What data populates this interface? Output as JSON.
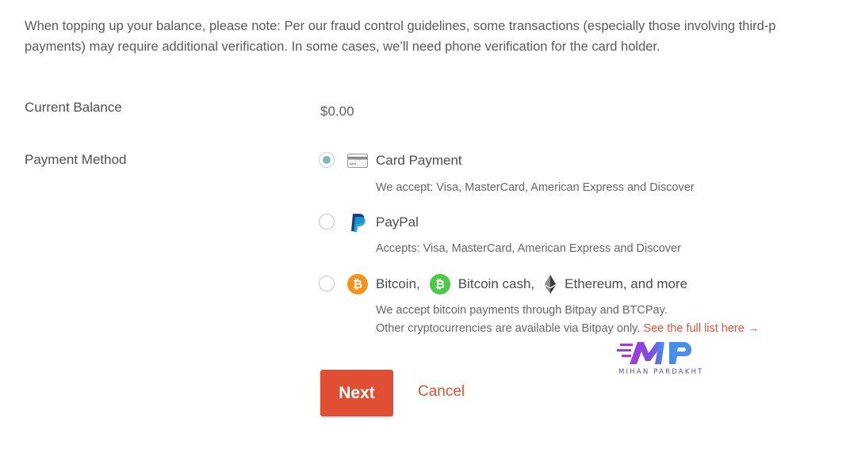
{
  "notice": {
    "line1": "When topping up your balance, please note: Per our fraud control guidelines, some transactions (especially those involving third-p",
    "line2": "payments) may require additional verification. In some cases, we’ll need phone verification for the card holder."
  },
  "balance": {
    "label": "Current Balance",
    "value": "$0.00"
  },
  "payment": {
    "label": "Payment Method",
    "options": [
      {
        "title": "Card Payment",
        "description": "We accept: Visa, MasterCard, American Express and Discover",
        "selected": true,
        "icon": "credit-card-icon"
      },
      {
        "title": "PayPal",
        "description": "Accepts: Visa, MasterCard, American Express and Discover",
        "selected": false,
        "icon": "paypal-icon"
      },
      {
        "items": [
          {
            "label": "Bitcoin,",
            "icon": "bitcoin-icon"
          },
          {
            "label": "Bitcoin cash,",
            "icon": "bitcoin-cash-icon"
          },
          {
            "label": "Ethereum, and more",
            "icon": "ethereum-icon"
          }
        ],
        "description_line1": "We accept bitcoin payments through Bitpay and BTCPay.",
        "description_line2": "Other cryptocurrencies are available via Bitpay only.",
        "link_text": "See the full list here →",
        "selected": false
      }
    ]
  },
  "actions": {
    "next_label": "Next",
    "cancel_label": "Cancel"
  },
  "watermark": {
    "text": "MIHAN PARDAKHT"
  },
  "colors": {
    "accent": "#e04e34",
    "link": "#d9553b",
    "radio_selected": "#7fb7bd",
    "bitcoin": "#f7931a",
    "bitcoin_cash": "#4cc947",
    "paypal_dark": "#253b80",
    "paypal_light": "#179bd7"
  }
}
